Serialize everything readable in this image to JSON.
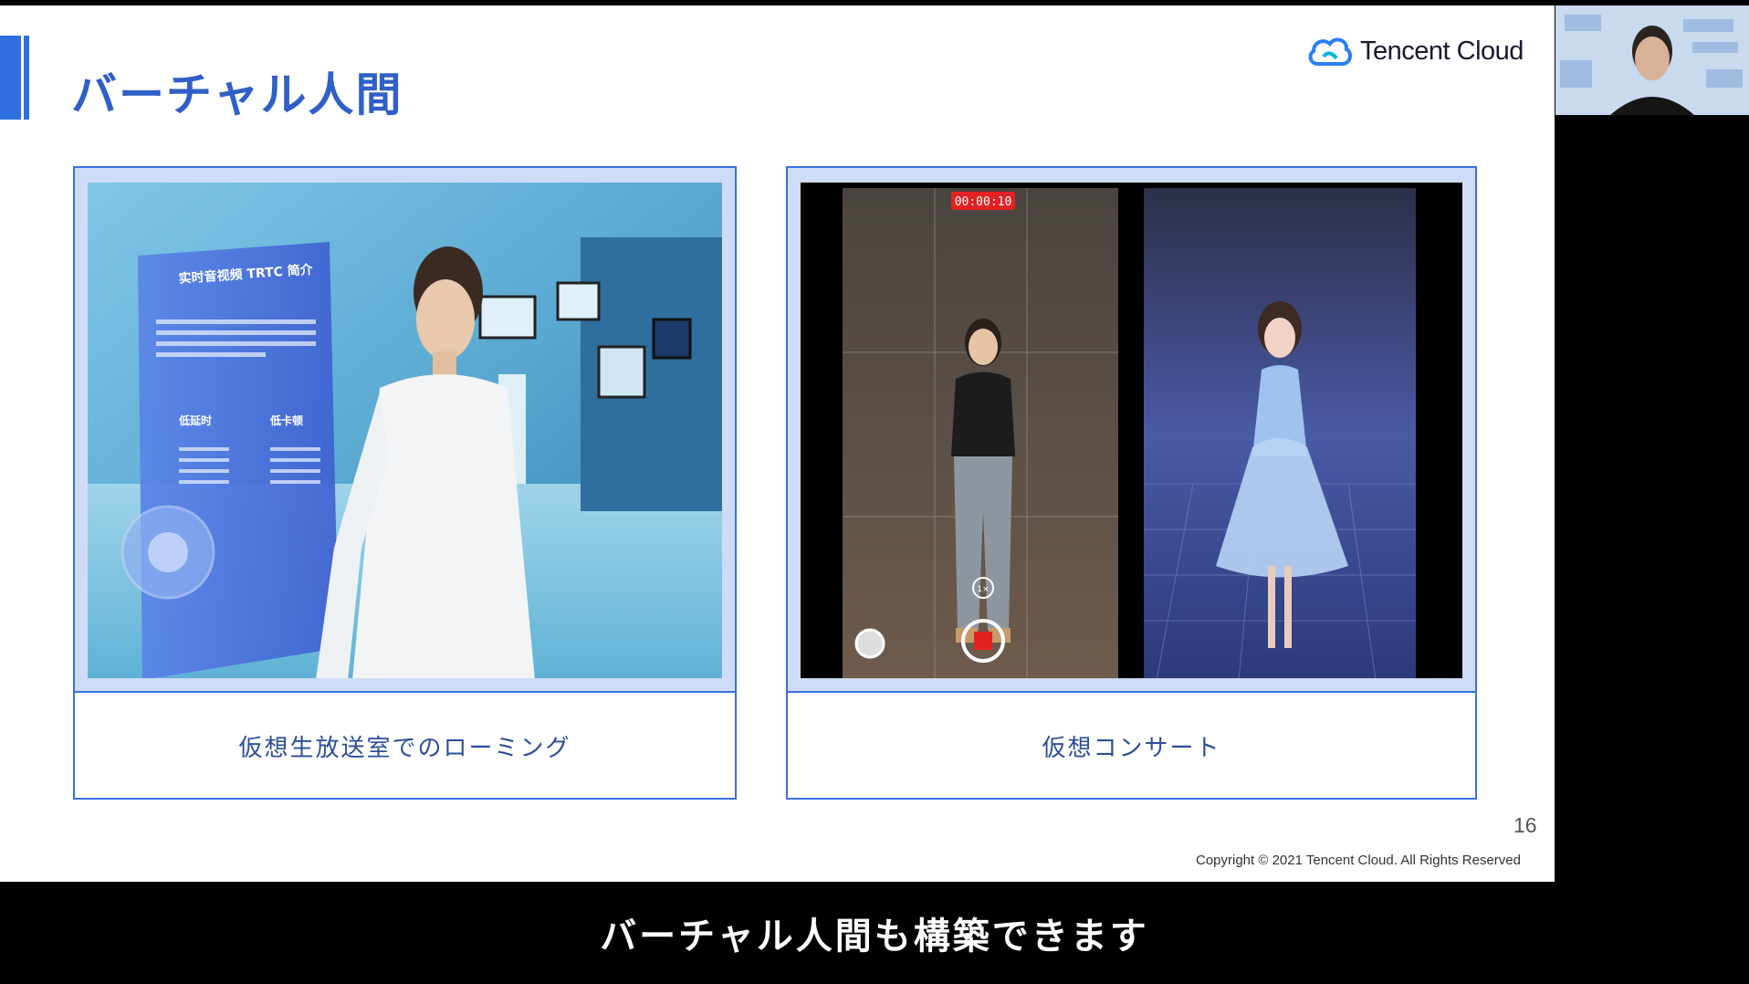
{
  "slide": {
    "title": "バーチャル人間",
    "logo_text": "Tencent Cloud",
    "page_number": "16",
    "copyright": "Copyright © 2021 Tencent Cloud. All Rights Reserved",
    "accent_color": "#2f6fe0",
    "cards": [
      {
        "caption": "仮想生放送室でのローミング",
        "screen_title": "实时音视频 TRTC 简介",
        "screen_col1_head": "低延时",
        "screen_col2_head": "低卡顿"
      },
      {
        "caption": "仮想コンサート",
        "record_timer": "00:00:10",
        "zoom_label": "1×"
      }
    ]
  },
  "subtitle": {
    "text": "バーチャル人間も構築できます"
  }
}
